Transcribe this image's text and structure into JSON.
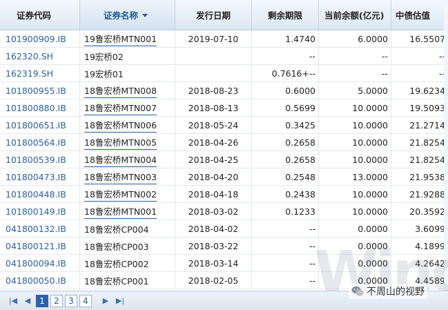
{
  "columns": [
    "证券代码",
    "证券名称",
    "发行日期",
    "剩余期限",
    "当前余额(亿元)",
    "中债估值"
  ],
  "rows": [
    {
      "code": "101900909.IB",
      "name": "19鲁宏桥MTN001",
      "date": "2019-07-10",
      "term": "1.4740",
      "balance": "6.0000",
      "val": "16.5507",
      "underline": true
    },
    {
      "code": "162320.SH",
      "name": "19宏桥02",
      "date": "",
      "term": "--",
      "balance": "--",
      "val": "--",
      "underline": false
    },
    {
      "code": "162319.SH",
      "name": "19宏桥01",
      "date": "",
      "term": "0.7616+--",
      "balance": "--",
      "val": "--",
      "underline": false
    },
    {
      "code": "101800955.IB",
      "name": "18鲁宏桥MTN008",
      "date": "2018-08-23",
      "term": "0.6000",
      "balance": "5.0000",
      "val": "19.6234",
      "underline": true
    },
    {
      "code": "101800880.IB",
      "name": "18鲁宏桥MTN007",
      "date": "2018-08-13",
      "term": "0.5699",
      "balance": "10.0000",
      "val": "19.5093",
      "underline": true
    },
    {
      "code": "101800651.IB",
      "name": "18鲁宏桥MTN006",
      "date": "2018-05-24",
      "term": "0.3425",
      "balance": "10.0000",
      "val": "21.2714",
      "underline": true
    },
    {
      "code": "101800564.IB",
      "name": "18鲁宏桥MTN005",
      "date": "2018-04-26",
      "term": "0.2658",
      "balance": "10.0000",
      "val": "21.8254",
      "underline": true
    },
    {
      "code": "101800539.IB",
      "name": "18鲁宏桥MTN004",
      "date": "2018-04-25",
      "term": "0.2658",
      "balance": "10.0000",
      "val": "21.8254",
      "underline": true
    },
    {
      "code": "101800473.IB",
      "name": "18鲁宏桥MTN003",
      "date": "2018-04-20",
      "term": "0.2548",
      "balance": "13.0000",
      "val": "21.9538",
      "underline": true
    },
    {
      "code": "101800448.IB",
      "name": "18鲁宏桥MTN002",
      "date": "2018-04-18",
      "term": "0.2438",
      "balance": "10.0000",
      "val": "21.9288",
      "underline": true
    },
    {
      "code": "101800149.IB",
      "name": "18鲁宏桥MTN001",
      "date": "2018-03-02",
      "term": "0.1233",
      "balance": "10.0000",
      "val": "20.3592",
      "underline": true
    },
    {
      "code": "041800132.IB",
      "name": "18鲁宏桥CP004",
      "date": "2018-04-02",
      "term": "--",
      "balance": "0.0000",
      "val": "3.6099",
      "underline": false
    },
    {
      "code": "041800121.IB",
      "name": "18鲁宏桥CP003",
      "date": "2018-03-22",
      "term": "--",
      "balance": "0.0000",
      "val": "4.1899",
      "underline": false
    },
    {
      "code": "041800094.IB",
      "name": "18鲁宏桥CP002",
      "date": "2018-03-14",
      "term": "--",
      "balance": "0.0000",
      "val": "4.2642",
      "underline": false
    },
    {
      "code": "041800050.IB",
      "name": "18鲁宏桥CP001",
      "date": "2018-02-05",
      "term": "--",
      "balance": "0.0000",
      "val": "4.4589",
      "underline": false
    }
  ],
  "pager": {
    "pages": [
      "1",
      "2",
      "3",
      "4"
    ],
    "active": "1",
    "first_icon": "first-page-icon",
    "prev_icon": "prev-page-icon",
    "next_icon": "next-page-icon",
    "last_icon": "last-page-icon"
  },
  "watermark": "Wind",
  "brand": "不周山的视野",
  "colors": {
    "link": "#2a5f9e",
    "active_page": "#2b62a8",
    "header_bg": "#dde8f3"
  }
}
